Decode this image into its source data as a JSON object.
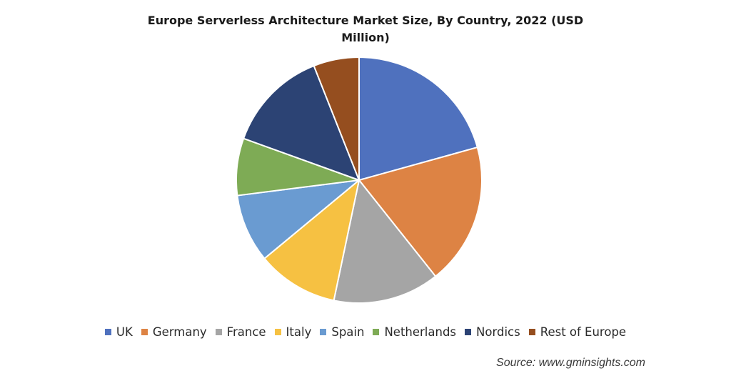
{
  "chart_data": {
    "type": "pie",
    "title_lines": [
      "Europe Serverless Architecture Market Size, By Country, 2022 (USD",
      "Million)"
    ],
    "title": "Europe Serverless Architecture Market Size, By Country, 2022 (USD Million)",
    "unit": "share (%) estimated from slice angles",
    "start_angle": "12 o'clock, clockwise",
    "legend_position": "bottom",
    "slices": [
      {
        "label": "UK",
        "value": 20.7,
        "color": "#4f71be"
      },
      {
        "label": "Germany",
        "value": 18.6,
        "color": "#dd8344"
      },
      {
        "label": "France",
        "value": 14.0,
        "color": "#a5a5a5"
      },
      {
        "label": "Italy",
        "value": 10.7,
        "color": "#f6c142"
      },
      {
        "label": "Spain",
        "value": 9.0,
        "color": "#6a9bd1"
      },
      {
        "label": "Netherlands",
        "value": 7.5,
        "color": "#7eab55"
      },
      {
        "label": "Nordics",
        "value": 13.5,
        "color": "#2c4374"
      },
      {
        "label": "Rest of Europe",
        "value": 6.0,
        "color": "#954e1f"
      }
    ]
  },
  "source": "Source: www.gminsights.com"
}
